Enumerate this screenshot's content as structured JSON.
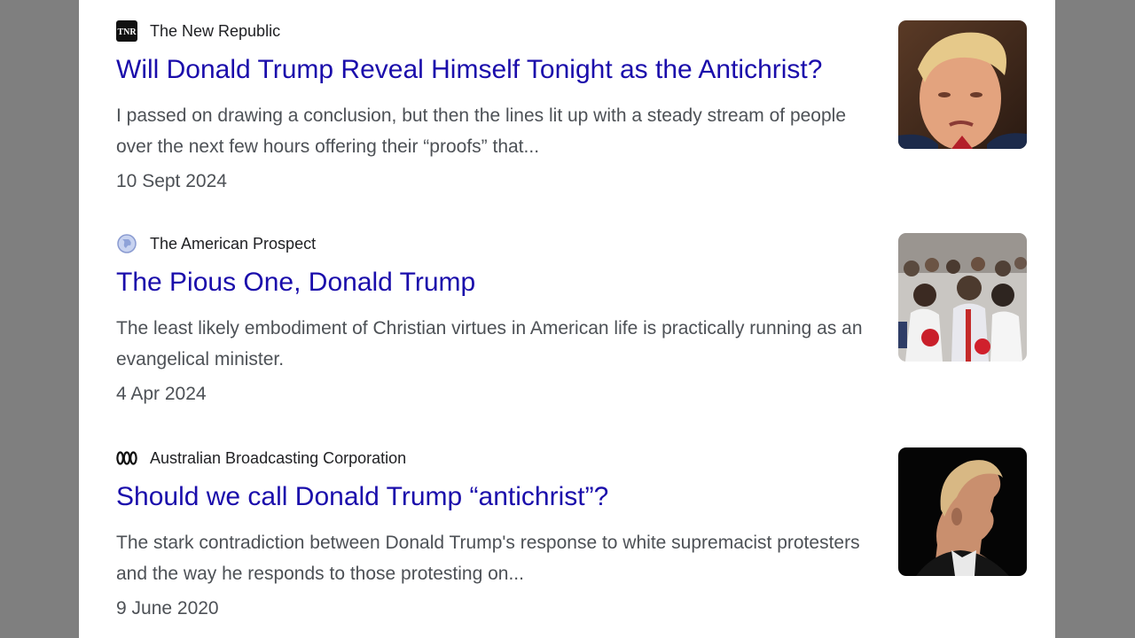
{
  "results": [
    {
      "source": "The New Republic",
      "favicon": "tnr-logo-icon",
      "title": "Will Donald Trump Reveal Himself Tonight as the Antichrist?",
      "snippet": "I passed on drawing a conclusion, but then the lines lit up with a steady stream of people over the next few hours offering their “proofs” that...",
      "date": "10 Sept 2024",
      "thumbnail": "donald-trump-portrait"
    },
    {
      "source": "The American Prospect",
      "favicon": "globe-icon",
      "title": "The Pious One, Donald Trump",
      "snippet": "The least likely embodiment of Christian virtues in American life is practically running as an evangelical minister.",
      "date": "4 Apr 2024",
      "thumbnail": "praying-crowd-photo"
    },
    {
      "source": "Australian Broadcasting Corporation",
      "favicon": "abc-logo-icon",
      "title": "Should we call Donald Trump “antichrist”?",
      "snippet": "The stark contradiction between Donald Trump's response to white supremacist protesters and the way he responds to those protesting on...",
      "date": "9 June 2020",
      "thumbnail": "donald-trump-profile-silhouette"
    }
  ],
  "colors": {
    "title_link": "#1a0dab",
    "snippet_text": "#4d5156",
    "source_text": "#202124",
    "side_background": "#7f7f7f"
  }
}
